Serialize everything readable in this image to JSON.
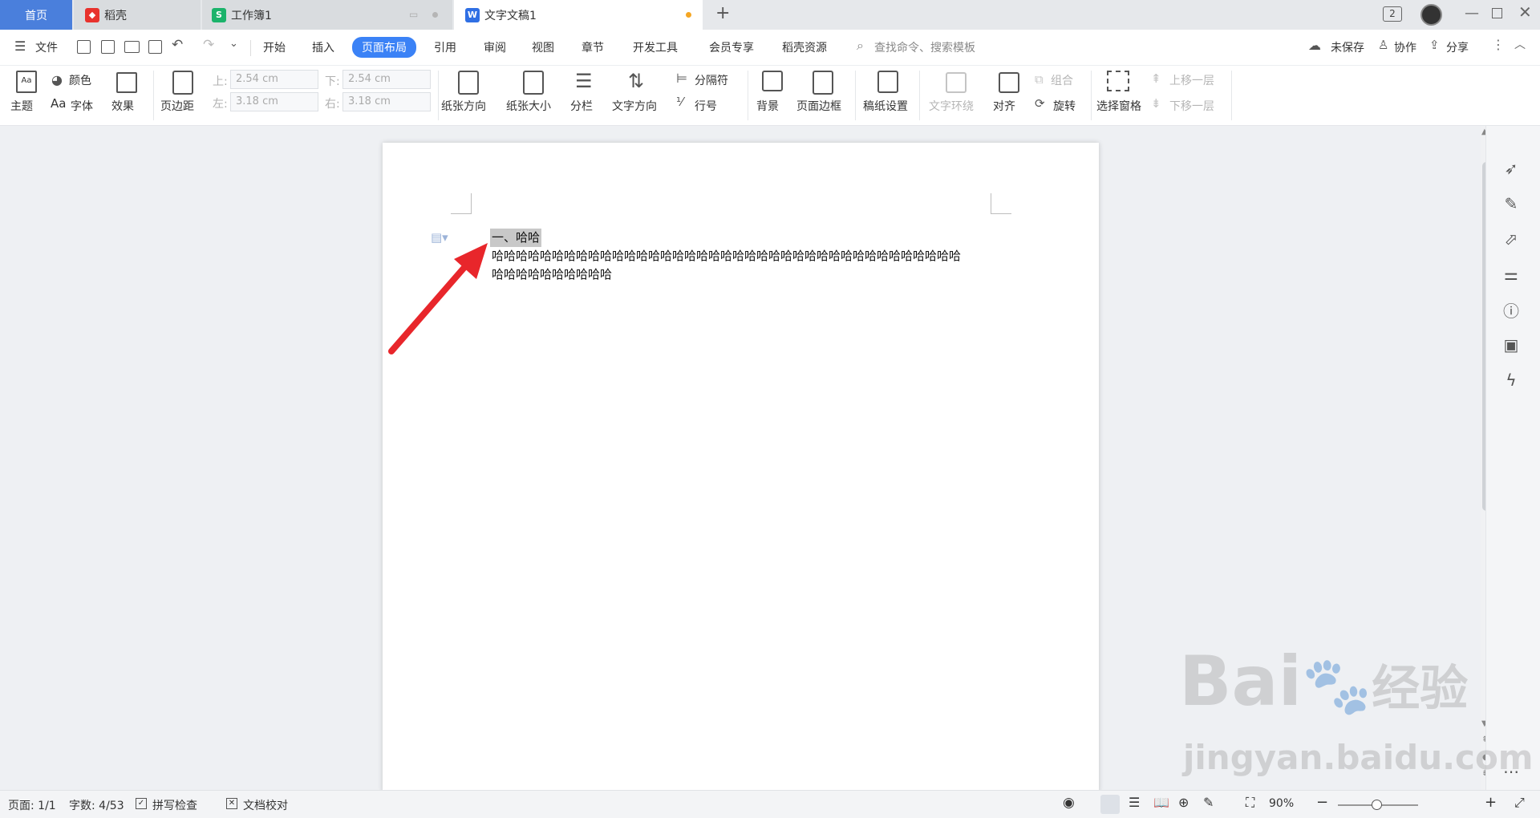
{
  "tabs": {
    "home": "首页",
    "daoke": "稻壳",
    "sheet": "工作簿1",
    "doc": "文字文稿1",
    "new_tab": "+",
    "count": "2"
  },
  "colors": {
    "home_tab": "#4a7fdc",
    "accent": "#3b82f6",
    "sheet_icon": "#1bb36b",
    "doc_icon": "#2f6fe4",
    "daoke_icon": "#e8322d",
    "unsaved_dot": "#f5a623",
    "arrow": "#e8262b"
  },
  "menu": {
    "file": "文件",
    "items": [
      "开始",
      "插入",
      "页面布局",
      "引用",
      "审阅",
      "视图",
      "章节",
      "开发工具",
      "会员专享",
      "稻壳资源"
    ],
    "active": "页面布局",
    "search": "查找命令、搜索模板",
    "unsaved": "未保存",
    "collab": "协作",
    "share": "分享"
  },
  "ribbon": {
    "theme": "主题",
    "color": "颜色",
    "font": "字体",
    "effect": "效果",
    "margin": "页边距",
    "top_lbl": "上:",
    "top_val": "2.54 cm",
    "bottom_lbl": "下:",
    "bottom_val": "2.54 cm",
    "left_lbl": "左:",
    "left_val": "3.18 cm",
    "right_lbl": "右:",
    "right_val": "3.18 cm",
    "orientation": "纸张方向",
    "size": "纸张大小",
    "columns": "分栏",
    "text_dir": "文字方向",
    "separator": "分隔符",
    "line_num": "行号",
    "background": "背景",
    "page_border": "页面边框",
    "manuscript": "稿纸设置",
    "wrap": "文字环绕",
    "align": "对齐",
    "group": "组合",
    "rotate": "旋转",
    "select_pane": "选择窗格",
    "move_up": "上移一层",
    "move_down": "下移一层",
    "aa": "Aa"
  },
  "document": {
    "heading": "一、哈哈",
    "line1": "哈哈哈哈哈哈哈哈哈哈哈哈哈哈哈哈哈哈哈哈哈哈哈哈哈哈哈哈哈哈哈哈哈哈哈哈哈哈哈",
    "line2": "哈哈哈哈哈哈哈哈哈哈"
  },
  "status": {
    "page": "页面: 1/1",
    "words": "字数: 4/53",
    "spell": "拼写检查",
    "proof": "文档校对",
    "zoom": "90%",
    "zoom_fraction": 0.48
  },
  "watermark": {
    "brand": "Bai",
    "brand2": "经验",
    "url": "jingyan.baidu.com"
  }
}
